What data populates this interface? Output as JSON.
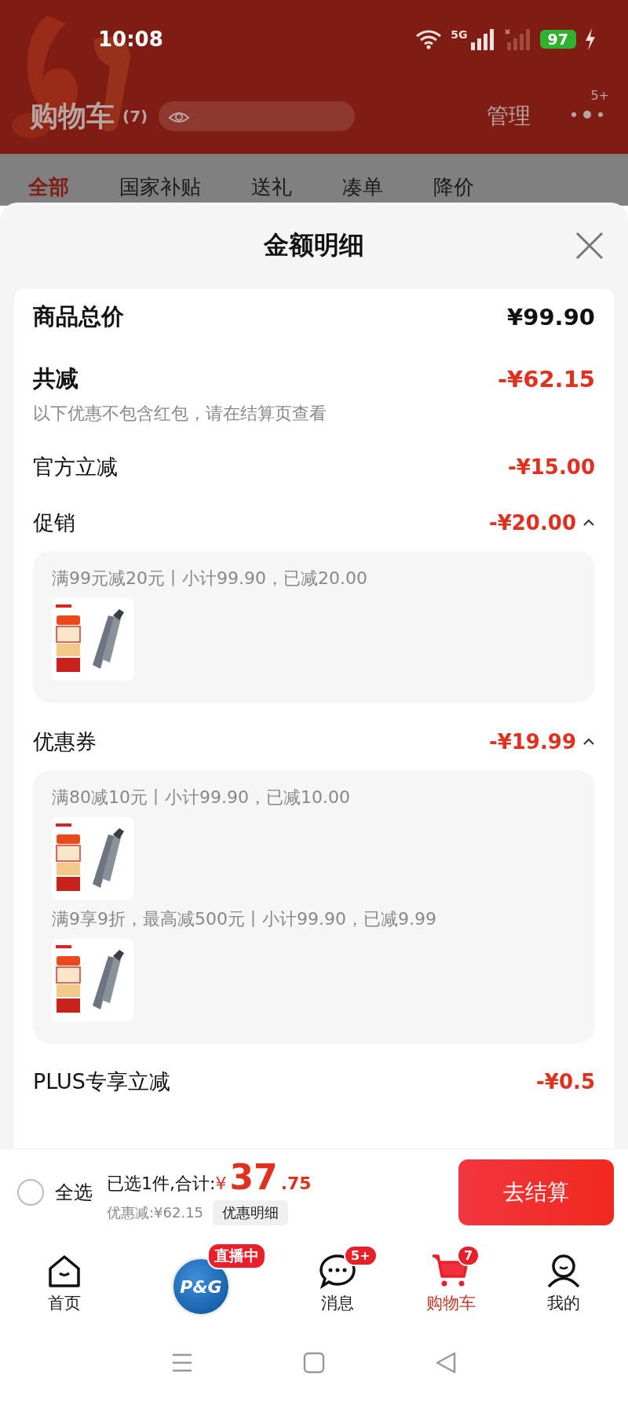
{
  "status_bar": {
    "time": "10:08",
    "network": "5G",
    "battery": "97"
  },
  "header": {
    "title": "购物车",
    "count": "(7)",
    "manage": "管理",
    "more_badge": "5+"
  },
  "tabs": [
    {
      "label": "全部",
      "selected": true
    },
    {
      "label": "国家补贴",
      "selected": false
    },
    {
      "label": "送礼",
      "selected": false
    },
    {
      "label": "凑单",
      "selected": false
    },
    {
      "label": "降价",
      "selected": false
    }
  ],
  "sheet": {
    "title": "金额明细",
    "rows": [
      {
        "kind": "total",
        "label": "商品总价",
        "amount": "¥99.90"
      },
      {
        "kind": "reduction",
        "label": "共减",
        "amount": "-¥62.15",
        "note": "以下优惠不包含红包，请在结算页查看"
      },
      {
        "kind": "line",
        "label": "官方立减",
        "amount": "-¥15.00"
      },
      {
        "kind": "group",
        "label": "促销",
        "amount": "-¥20.00",
        "expanded": true,
        "entries": [
          {
            "text": "满99元减20元丨小计99.90，已减20.00"
          }
        ]
      },
      {
        "kind": "group",
        "label": "优惠券",
        "amount": "-¥19.99",
        "expanded": true,
        "entries": [
          {
            "text": "满80减10元丨小计99.90，已减10.00"
          },
          {
            "text": "满9享9折，最高减500元丨小计99.90，已减9.99"
          }
        ]
      },
      {
        "kind": "line",
        "label": "PLUS专享立减",
        "amount": "-¥0.5"
      }
    ]
  },
  "bottom_bar": {
    "select_all": {
      "label": "全选",
      "checked": false
    },
    "summary": "已选1件,合计:",
    "currency": "¥",
    "amount_int": "37",
    "amount_dec": ".75",
    "discount": "优惠减:¥62.15",
    "detail_button": "优惠明细",
    "checkout": "去结算"
  },
  "nav": [
    {
      "kind": "home",
      "label": "首页",
      "selected": false
    },
    {
      "kind": "live",
      "logo": "P&G",
      "badge": "直播中",
      "selected": false
    },
    {
      "kind": "message",
      "label": "消息",
      "badge": "5+",
      "selected": false
    },
    {
      "kind": "cart",
      "label": "购物车",
      "badge": "7",
      "selected": true
    },
    {
      "kind": "me",
      "label": "我的",
      "selected": false
    }
  ]
}
